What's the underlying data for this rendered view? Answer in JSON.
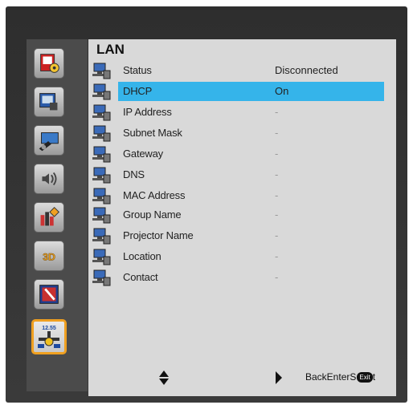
{
  "menu": {
    "title": "LAN",
    "rows": [
      {
        "label": "Status",
        "value": "Disconnected"
      },
      {
        "label": "DHCP",
        "value": "On"
      },
      {
        "label": "IP Address",
        "value": "-"
      },
      {
        "label": "Subnet Mask",
        "value": "-"
      },
      {
        "label": "Gateway",
        "value": "-"
      },
      {
        "label": "DNS",
        "value": "-"
      },
      {
        "label": "MAC Address",
        "value": "-"
      },
      {
        "label": "Group Name",
        "value": "-"
      },
      {
        "label": "Projector Name",
        "value": "-"
      },
      {
        "label": "Location",
        "value": "-"
      },
      {
        "label": "Contact",
        "value": "-"
      }
    ]
  },
  "sidebar": {
    "items": [
      {
        "icon": "image-settings-icon"
      },
      {
        "icon": "display-settings-icon"
      },
      {
        "icon": "setup-icon"
      },
      {
        "icon": "volume-icon"
      },
      {
        "icon": "options-icon"
      },
      {
        "icon": "3d-icon",
        "text": "3D"
      },
      {
        "icon": "interactive-icon"
      },
      {
        "icon": "lan-icon",
        "text": "12.55"
      }
    ],
    "selected_index": 7
  },
  "footer": {
    "text": "BackEnterS",
    "key_text": "Exit",
    "after_key": "t"
  },
  "colors": {
    "highlight": "#35b4ea",
    "active_border": "#f0a020"
  }
}
